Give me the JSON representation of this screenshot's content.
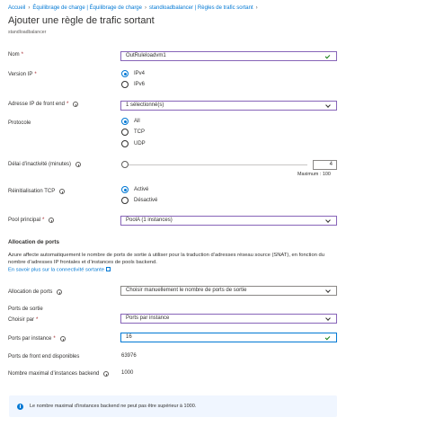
{
  "breadcrumb": [
    "Accueil",
    "Équilibrage de charge | Équilibrage de charge",
    "standloadbalancer | Règles de trafic sortant"
  ],
  "page": {
    "title": "Ajouter une règle de trafic sortant",
    "subtitle": "standloadbalancer"
  },
  "form": {
    "name": {
      "label": "Nom",
      "value": "OutRuleloadvm1"
    },
    "ip_version": {
      "label": "Version IP",
      "options": [
        "IPv4",
        "IPv6"
      ],
      "selected": "IPv4"
    },
    "frontend_ip": {
      "label": "Adresse IP de front end",
      "value": "1 sélectionné(s)"
    },
    "protocol": {
      "label": "Protocole",
      "options": [
        "All",
        "TCP",
        "UDP"
      ],
      "selected": "All"
    },
    "idle_timeout": {
      "label": "Délai d’inactivité (minutes)",
      "value": "4",
      "max_label": "Maximum : 100",
      "level": 0.0
    },
    "tcp_reset": {
      "label": "Réinitialisation TCP",
      "options": [
        "Activé",
        "Désactivé"
      ],
      "selected": "Activé"
    },
    "backend_pool": {
      "label": "Pool principal",
      "value": "PoolA (1 instances)"
    }
  },
  "port_allocation": {
    "heading": "Allocation de ports",
    "description": "Azure affecte automatiquement le nombre de ports de sortie à utiliser pour la traduction d’adresses réseau source (SNAT), en fonction du nombre d’adresses IP frontales et d’instances de pools backend.",
    "learn_more": "En savoir plus sur la connectivité sortante",
    "allocation": {
      "label": "Allocation de ports",
      "value": "Choisir manuellement le nombre de ports de sortie"
    },
    "outbound_ports_heading": "Ports de sortie",
    "choose_by": {
      "label": "Choisir par",
      "value": "Ports par instance"
    },
    "ports_per_instance": {
      "label": "Ports par instance",
      "value": "16"
    },
    "available_frontend_ports": {
      "label": "Ports de front end disponibles",
      "value": "63976"
    },
    "max_backend_instances": {
      "label": "Nombre maximal d’instances backend",
      "value": "1000"
    }
  },
  "info_message": "Le nombre maximal d’instances backend ne peut pas être supérieur à 1000.",
  "colors": {
    "accent": "#0078d4",
    "valid_border": "#8764b8",
    "info_bg": "#f0f6ff",
    "required": "#a4262c"
  }
}
